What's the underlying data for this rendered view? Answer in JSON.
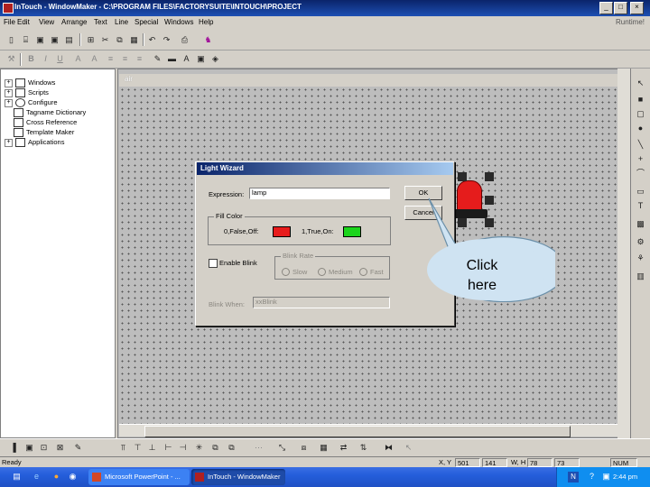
{
  "window": {
    "title": "InTouch - WindowMaker - C:\\PROGRAM FILES\\FACTORYSUITE\\INTOUCH\\PROJECT",
    "min_label": "_",
    "max_label": "□",
    "close_label": "×"
  },
  "menu": {
    "items": [
      "File",
      "Edit",
      "View",
      "Arrange",
      "Text",
      "Line",
      "Special",
      "Windows",
      "Help"
    ],
    "runtime_label": "Runtime!"
  },
  "toolbar1": [
    "new-icon",
    "open-icon",
    "save-icon",
    "save-all-icon",
    "close-icon",
    "grid-icon",
    "cut-icon",
    "copy-icon",
    "paste-icon",
    "undo-icon",
    "redo-icon",
    "print-icon",
    "wizard-icon"
  ],
  "toolbar2": {
    "font_buttons": [
      "B",
      "I",
      "U"
    ],
    "align_buttons": [
      "A",
      "A"
    ]
  },
  "tree": {
    "items": [
      {
        "label": "Windows",
        "expander": "+"
      },
      {
        "label": "Scripts",
        "expander": "+"
      },
      {
        "label": "Configure",
        "expander": "+"
      },
      {
        "label": "Tagname Dictionary",
        "expander": ""
      },
      {
        "label": "Cross Reference",
        "expander": ""
      },
      {
        "label": "Template Maker",
        "expander": ""
      },
      {
        "label": "Applications",
        "expander": "+"
      }
    ]
  },
  "child_window": {
    "title": "air"
  },
  "dialog": {
    "title": "Light Wizard",
    "expression_label": "Expression:",
    "expression_value": "lamp",
    "ok_label": "OK",
    "cancel_label": "Cancel",
    "fill_color_label": "Fill Color",
    "false_label": "0,False,Off:",
    "true_label": "1,True,On:",
    "false_color": "#e81c1c",
    "true_color": "#1cd41c",
    "enable_blink_label": "Enable Blink",
    "blink_rate_label": "Blink Rate",
    "blink_rates": [
      "Slow",
      "Medium",
      "Fast"
    ],
    "blink_when_label": "Blink When:",
    "blink_when_value": "xxBlink"
  },
  "callout": {
    "line1": "Click",
    "line2": "here"
  },
  "status": {
    "ready": "Ready",
    "xy_label": "X, Y",
    "x_value": "501",
    "y_value": "141",
    "wh_label": "W, H",
    "w_value": "78",
    "h_value": "73",
    "num": "NUM"
  },
  "taskbar": {
    "tasks": [
      "Microsoft PowerPoint - ...",
      "InTouch - WindowMaker"
    ],
    "tray_lang": "N",
    "clock": "2:44 pm"
  },
  "colors": {
    "title_bar": "#0a246a",
    "taskbar": "#245edb",
    "callout_fill": "#cfe3f2",
    "lamp_red": "#e51c1c"
  }
}
